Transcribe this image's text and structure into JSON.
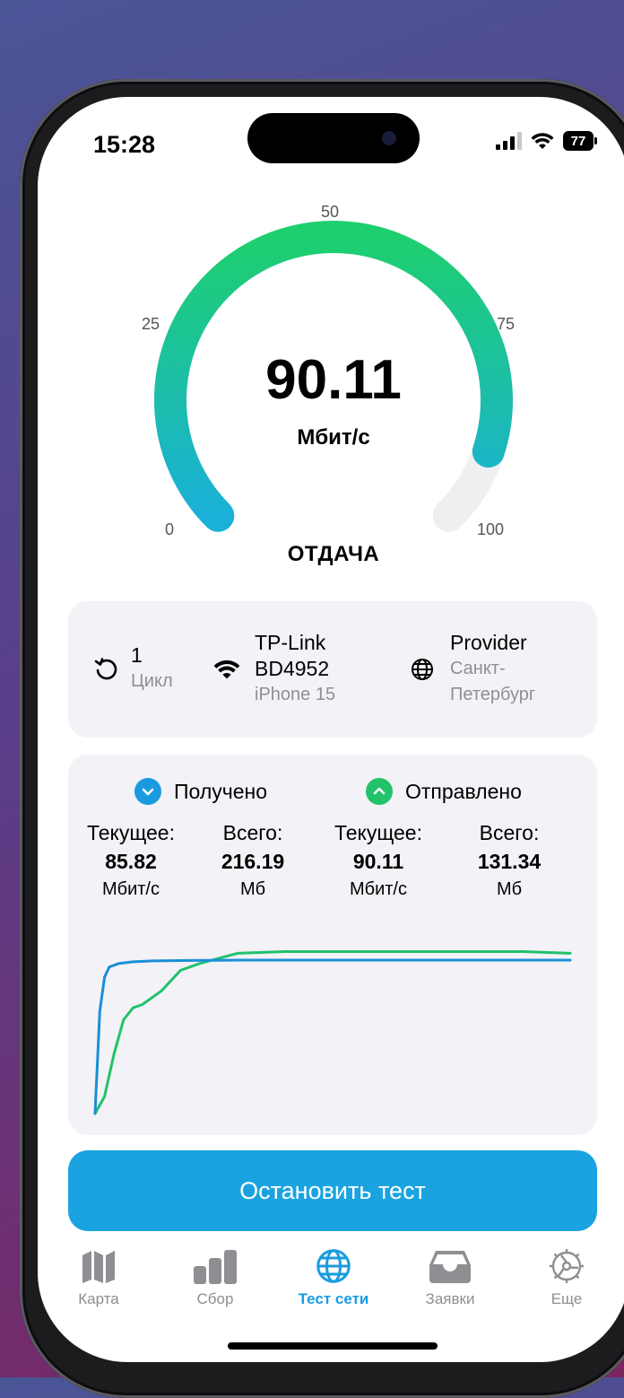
{
  "status_bar": {
    "time": "15:28",
    "battery": "77"
  },
  "gauge": {
    "value": "90.11",
    "unit": "Мбит/с",
    "label": "ОТДАЧА",
    "ticks": [
      "0",
      "25",
      "50",
      "75",
      "100"
    ],
    "fill_fraction": 0.9011,
    "colors": {
      "start": "#1ab0d8",
      "end": "#1ecf6e",
      "track": "#efeff2"
    }
  },
  "info": {
    "cycle": {
      "value": "1",
      "label": "Цикл"
    },
    "network": {
      "name_line1": "TP-Link",
      "name_line2": "BD4952",
      "device": "iPhone 15"
    },
    "provider": {
      "name": "Provider",
      "city_line1": "Санкт-",
      "city_line2": "Петербург"
    }
  },
  "stats": {
    "received": {
      "title": "Получено",
      "color": "#1a9be0",
      "current_label": "Текущее:",
      "current_value": "85.82",
      "current_unit": "Мбит/с",
      "total_label": "Всего:",
      "total_value": "216.19",
      "total_unit": "Мб"
    },
    "sent": {
      "title": "Отправлено",
      "color": "#21c26a",
      "current_label": "Текущее:",
      "current_value": "90.11",
      "current_unit": "Мбит/с",
      "total_label": "Всего:",
      "total_value": "131.34",
      "total_unit": "Мб"
    }
  },
  "chart_data": {
    "type": "line",
    "series": [
      {
        "color": "#1a8fd6",
        "x": [
          0,
          1,
          2,
          3,
          5,
          8,
          12,
          20,
          30,
          50,
          100
        ],
        "y": [
          0,
          60,
          80,
          86,
          88,
          89,
          89.5,
          89.8,
          90,
          90,
          90
        ]
      },
      {
        "color": "#21c26a",
        "x": [
          0,
          2,
          4,
          6,
          8,
          10,
          14,
          18,
          22,
          26,
          30,
          40,
          60,
          80,
          90,
          100
        ],
        "y": [
          0,
          10,
          35,
          55,
          62,
          64,
          72,
          84,
          88,
          91,
          94,
          95,
          95,
          95,
          95,
          94
        ]
      }
    ],
    "xlim": [
      0,
      100
    ],
    "ylim": [
      0,
      100
    ],
    "grid": false
  },
  "actions": {
    "stop_label": "Остановить тест"
  },
  "tabs": [
    {
      "label": "Карта",
      "icon": "map-icon"
    },
    {
      "label": "Сбор",
      "icon": "bar-chart-icon"
    },
    {
      "label": "Тест сети",
      "icon": "globe-icon",
      "active": true
    },
    {
      "label": "Заявки",
      "icon": "inbox-icon"
    },
    {
      "label": "Еще",
      "icon": "gear-icon"
    }
  ]
}
